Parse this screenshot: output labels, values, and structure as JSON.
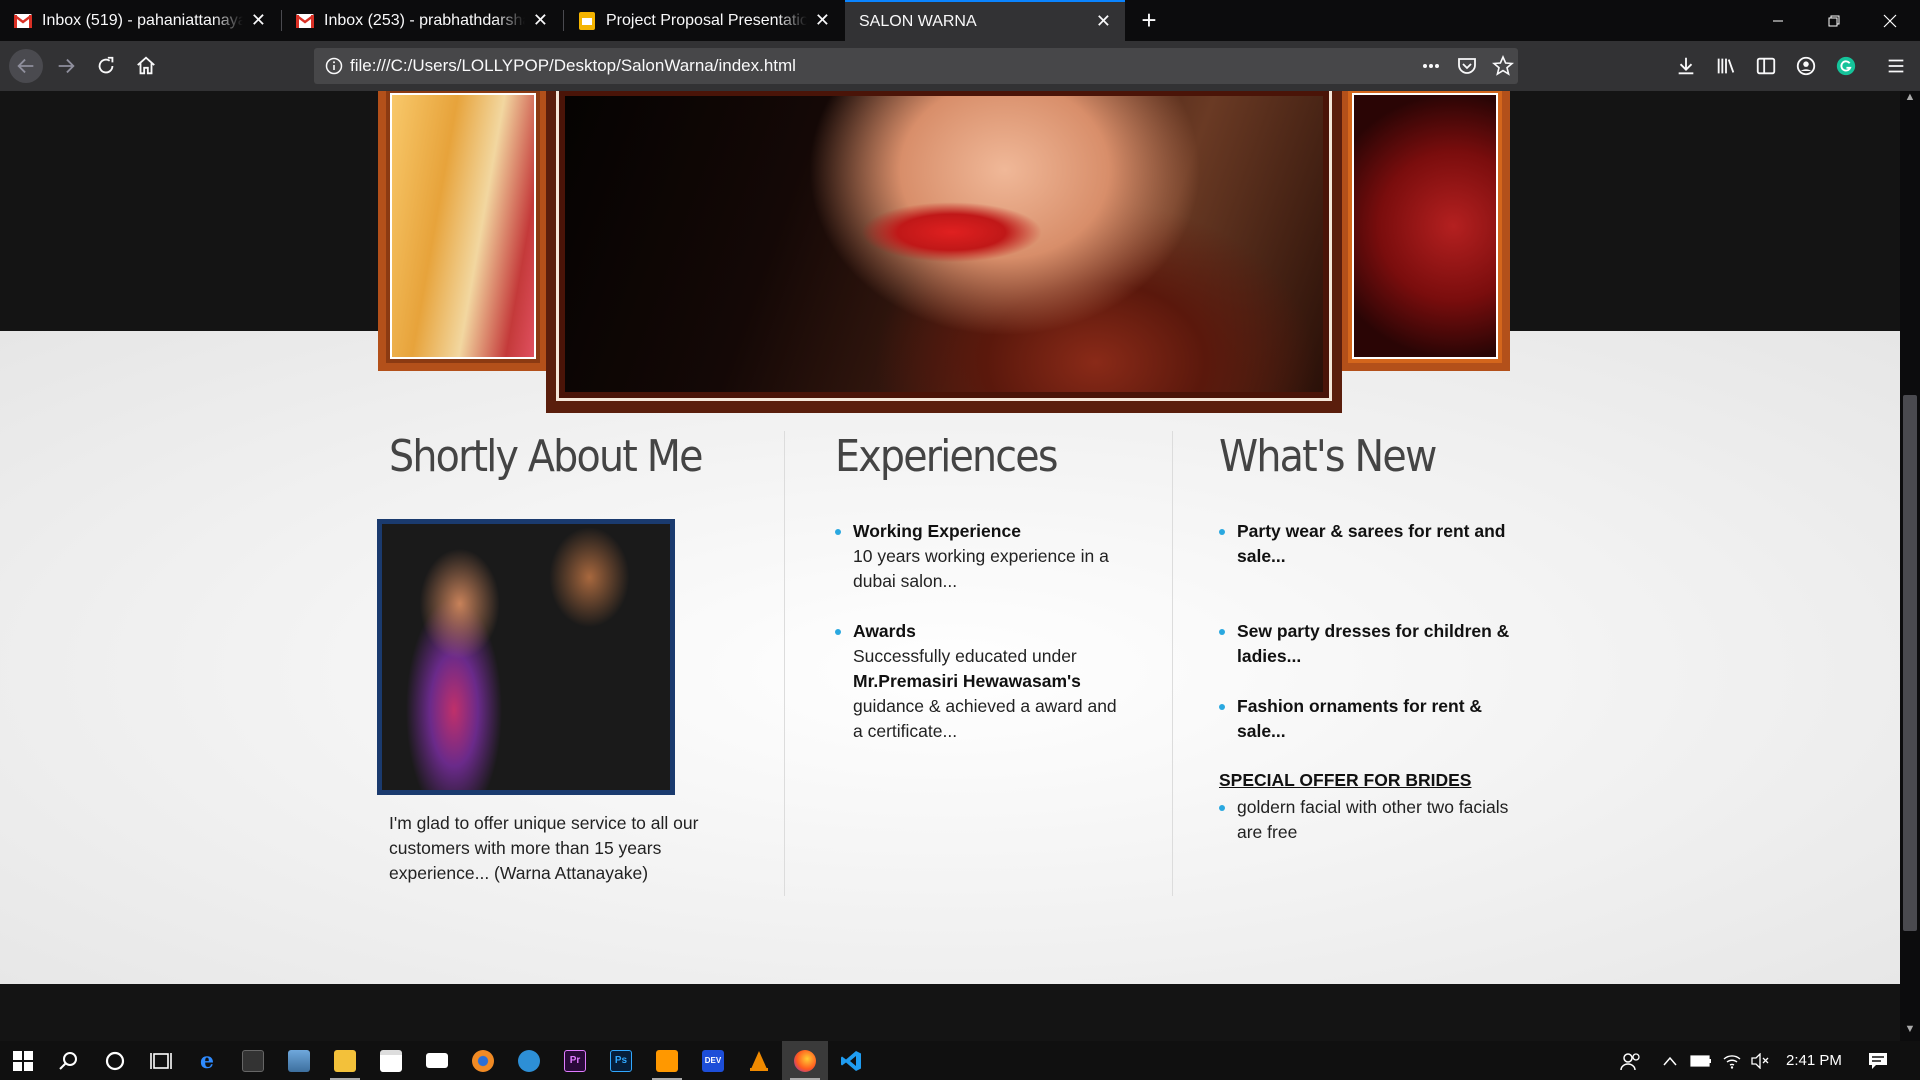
{
  "browser": {
    "tabs": [
      {
        "title": "Inbox (519) - pahaniattanayake",
        "icon": "gmail-icon"
      },
      {
        "title": "Inbox (253) - prabhathdarshana",
        "icon": "gmail-icon"
      },
      {
        "title": "Project Proposal Presentation - ",
        "icon": "slides-icon"
      },
      {
        "title": "SALON WARNA",
        "icon": "none"
      }
    ],
    "url": "file:///C:/Users/LOLLYPOP/Desktop/SalonWarna/index.html"
  },
  "page": {
    "about": {
      "heading": "Shortly About Me",
      "text": "I'm glad to offer unique service to all our customers with more than 15 years experience... (Warna Attanayake)"
    },
    "experiences": {
      "heading": "Experiences",
      "items": [
        {
          "title": "Working Experience",
          "text": "10 years working experience in a dubai salon..."
        },
        {
          "title": "Awards",
          "text_before": "Successfully educated under ",
          "bold": "Mr.Premasiri Hewawasam's",
          "text_after": " guidance & achieved a award and a certificate..."
        }
      ]
    },
    "whats_new": {
      "heading": "What's New",
      "items": [
        "Party wear & sarees for rent and sale...",
        "Sew party dresses for children & ladies...",
        "Fashion ornaments for rent & sale..."
      ],
      "offer_title": "SPECIAL OFFER FOR BRIDES",
      "offer_items": [
        "goldern facial with other two facials are free"
      ]
    }
  },
  "taskbar": {
    "time": "2:41 PM"
  },
  "colors": {
    "bullet": "#2aa8e0",
    "frame_brown": "#5a1e0c",
    "frame_orange": "#d4661c",
    "accent_tab": "#0a84ff"
  }
}
